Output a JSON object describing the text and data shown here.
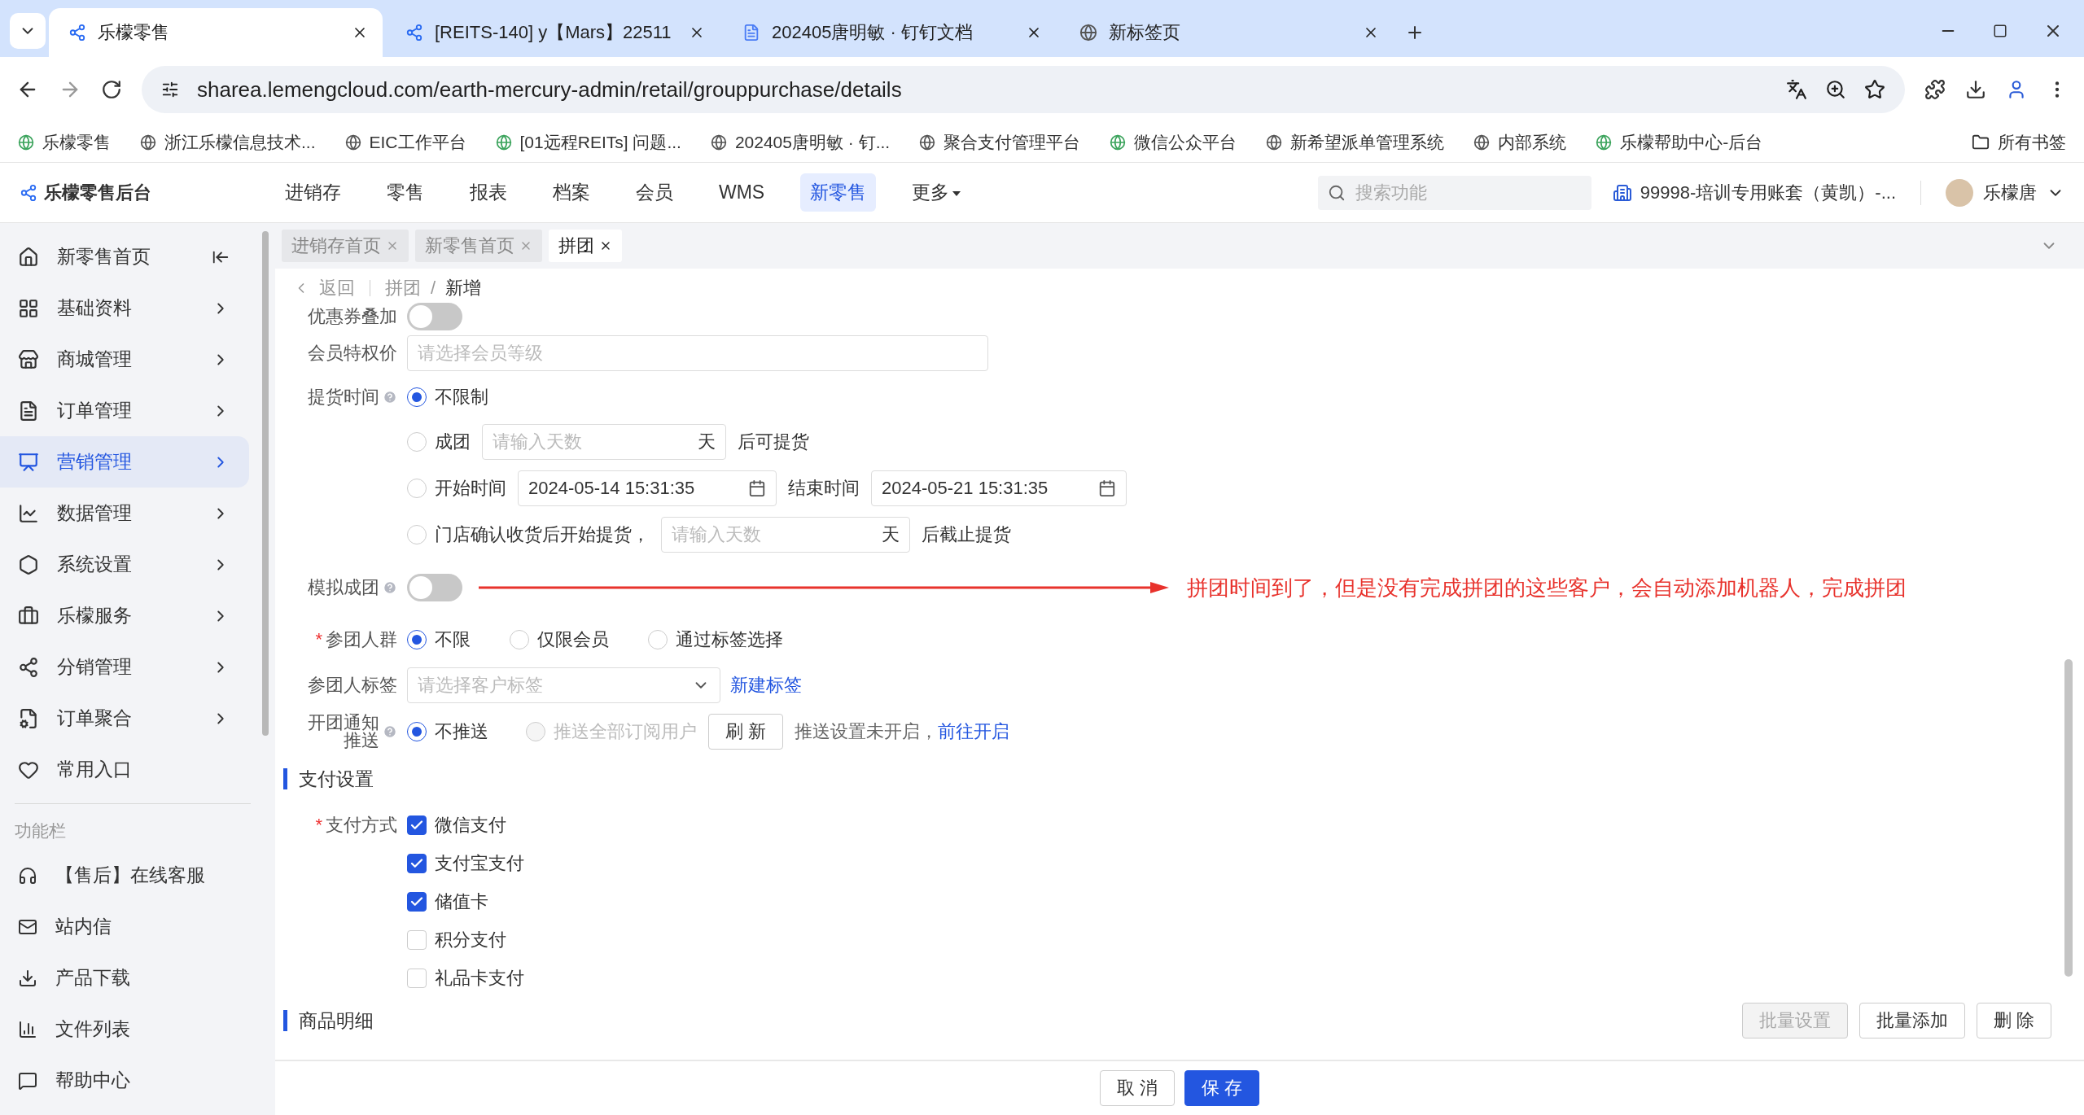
{
  "browser": {
    "tabs": [
      {
        "title": "乐檬零售",
        "selected": true
      },
      {
        "title": "[REITS-140] y【Mars】22511",
        "selected": false
      },
      {
        "title": "202405唐明敏 · 钉钉文档",
        "selected": false
      },
      {
        "title": "新标签页",
        "selected": false
      }
    ],
    "address": "sharea.lemengcloud.com/earth-mercury-admin/retail/grouppurchase/details",
    "bookmarks": [
      "乐檬零售",
      "浙江乐檬信息技术...",
      "EIC工作平台",
      "[01远程REITs] 问题...",
      "202405唐明敏 · 钉...",
      "聚合支付管理平台",
      "微信公众平台",
      "新希望派单管理系统",
      "内部系统",
      "乐檬帮助中心-后台"
    ],
    "bookmark_folder": "所有书签"
  },
  "header": {
    "logo": "乐檬零售后台",
    "nav": [
      {
        "label": "进销存",
        "selected": false
      },
      {
        "label": "零售",
        "selected": false
      },
      {
        "label": "报表",
        "selected": false
      },
      {
        "label": "档案",
        "selected": false
      },
      {
        "label": "会员",
        "selected": false
      },
      {
        "label": "WMS",
        "selected": false
      },
      {
        "label": "新零售",
        "selected": true
      }
    ],
    "more": "更多",
    "search": {
      "placeholder": "搜索功能"
    },
    "account": "99998-培训专用账套（黄凯）-...",
    "user": "乐檬唐"
  },
  "sidebar": {
    "items": [
      {
        "label": "新零售首页",
        "selected": false
      },
      {
        "label": "基础资料",
        "selected": false
      },
      {
        "label": "商城管理",
        "selected": false
      },
      {
        "label": "订单管理",
        "selected": false
      },
      {
        "label": "营销管理",
        "selected": true
      },
      {
        "label": "数据管理",
        "selected": false
      },
      {
        "label": "系统设置",
        "selected": false
      },
      {
        "label": "乐檬服务",
        "selected": false
      },
      {
        "label": "分销管理",
        "selected": false
      },
      {
        "label": "订单聚合",
        "selected": false
      },
      {
        "label": "常用入口",
        "selected": false
      }
    ],
    "section": "功能栏",
    "tools": [
      "【售后】在线客服",
      "站内信",
      "产品下载",
      "文件列表",
      "帮助中心"
    ]
  },
  "page_tabs": [
    {
      "label": "进销存首页",
      "selected": false
    },
    {
      "label": "新零售首页",
      "selected": false
    },
    {
      "label": "拼团",
      "selected": true
    }
  ],
  "breadcrumb": {
    "back": "返回",
    "path": [
      "拼团",
      "新增"
    ],
    "separator": "/"
  },
  "form": {
    "coupon_stack": {
      "label": "优惠券叠加",
      "on": false
    },
    "member_price": {
      "label": "会员特权价",
      "placeholder": "请选择会员等级"
    },
    "pickup": {
      "label": "提货时间",
      "options": [
        {
          "kind": "plain",
          "label": "不限制",
          "selected": true
        },
        {
          "kind": "days",
          "label": "成团",
          "placeholder": "请输入天数",
          "unit": "天",
          "suffix": "后可提货",
          "selected": false
        },
        {
          "kind": "range",
          "label": "开始时间",
          "start": "2024-05-14 15:31:35",
          "end_label": "结束时间",
          "end": "2024-05-21 15:31:35",
          "selected": false
        },
        {
          "kind": "days",
          "label": "门店确认收货后开始提货，",
          "placeholder": "请输入天数",
          "unit": "天",
          "suffix": "后截止提货",
          "selected": false
        }
      ]
    },
    "simulate": {
      "label": "模拟成团",
      "on": false,
      "annotation": "拼团时间到了，但是没有完成拼团的这些客户，会自动添加机器人，完成拼团"
    },
    "crowd": {
      "label": "参团人群",
      "required_mark": "*",
      "options": [
        {
          "label": "不限",
          "selected": true
        },
        {
          "label": "仅限会员",
          "selected": false
        },
        {
          "label": "通过标签选择",
          "selected": false
        }
      ]
    },
    "crowd_tag": {
      "label": "参团人标签",
      "placeholder": "请选择客户标签",
      "link": "新建标签"
    },
    "notify": {
      "label_lines": [
        "开团通知",
        "推送"
      ],
      "options": [
        {
          "label": "不推送",
          "selected": true,
          "disabled": false
        },
        {
          "label": "推送全部订阅用户",
          "selected": false,
          "disabled": true
        }
      ],
      "refresh": "刷 新",
      "note": "推送设置未开启，",
      "link": "前往开启"
    },
    "payment_section": "支付设置",
    "payment": {
      "label": "支付方式",
      "required_mark": "*",
      "options": [
        {
          "label": "微信支付",
          "checked": true
        },
        {
          "label": "支付宝支付",
          "checked": true
        },
        {
          "label": "储值卡",
          "checked": true
        },
        {
          "label": "积分支付",
          "checked": false
        },
        {
          "label": "礼品卡支付",
          "checked": false
        }
      ]
    },
    "goods_section": "商品明细",
    "goods_buttons": [
      {
        "label": "批量设置",
        "disabled": true
      },
      {
        "label": "批量添加",
        "disabled": false
      },
      {
        "label": "删 除",
        "disabled": false
      }
    ]
  },
  "footer": [
    {
      "label": "取 消",
      "kind": "default"
    },
    {
      "label": "保 存",
      "kind": "primary"
    }
  ]
}
